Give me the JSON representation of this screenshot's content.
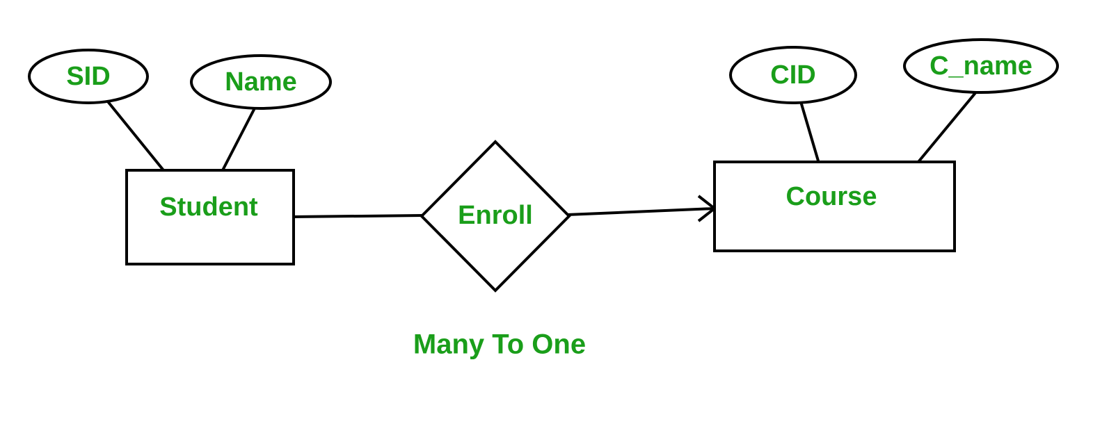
{
  "entities": {
    "student": {
      "label": "Student",
      "attributes": {
        "sid": "SID",
        "name": "Name"
      }
    },
    "course": {
      "label": "Course",
      "attributes": {
        "cid": "CID",
        "cname": "C_name"
      }
    }
  },
  "relationship": {
    "label": "Enroll"
  },
  "caption": "Many To One"
}
